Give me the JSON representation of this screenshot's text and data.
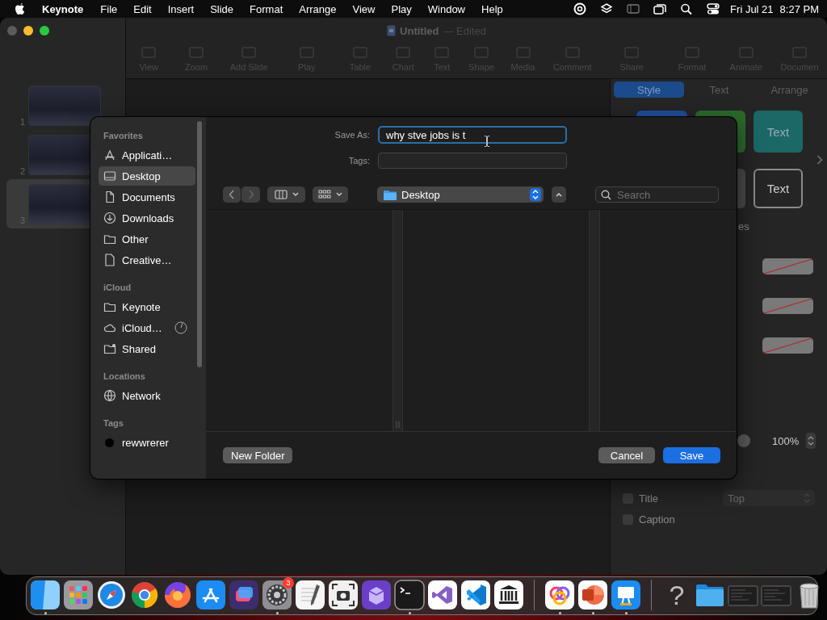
{
  "menu_bar": {
    "app_name": "Keynote",
    "menus": [
      "File",
      "Edit",
      "Insert",
      "Slide",
      "Format",
      "Arrange",
      "View",
      "Play",
      "Window",
      "Help"
    ],
    "date": "Fri Jul 21",
    "time": "8:27 PM"
  },
  "window": {
    "title": "Untitled",
    "status": "— Edited",
    "toolbar": [
      "View",
      "Zoom",
      "Add Slide",
      "Play",
      "Table",
      "Chart",
      "Text",
      "Shape",
      "Media",
      "Comment",
      "Share",
      "Format",
      "Animate",
      "Documen"
    ]
  },
  "slides": [
    {
      "number": "1",
      "selected": false
    },
    {
      "number": "2",
      "selected": false
    },
    {
      "number": "3",
      "selected": true
    }
  ],
  "inspector": {
    "tabs": [
      {
        "label": "Style",
        "selected": true
      },
      {
        "label": "Text",
        "selected": false
      },
      {
        "label": "Arrange",
        "selected": false
      }
    ],
    "presets": [
      {
        "kind": "filled",
        "color": "#1e4f9c"
      },
      {
        "kind": "filled",
        "color": "#2c6a2c"
      },
      {
        "kind": "filled",
        "color": "#1b6866",
        "label": "Text"
      },
      {
        "kind": "filled",
        "color": "#4a4a4a"
      },
      {
        "kind": "outlined",
        "label": "Text"
      }
    ],
    "section_heading": "es",
    "fill_wells": [
      {
        "kind": "empty"
      },
      {
        "kind": "empty"
      },
      {
        "kind": "empty"
      }
    ],
    "opacity": {
      "reading": "100%"
    },
    "options": [
      {
        "label": "Title",
        "checked": false
      },
      {
        "label": "Caption",
        "checked": false
      }
    ],
    "position_popup": {
      "value": "Top",
      "disabled": true
    }
  },
  "save_dialog": {
    "sidebar": [
      {
        "heading": "Favorites",
        "items": [
          {
            "label": "Applicati…",
            "kind": "apps",
            "selected": false,
            "syncing": false
          },
          {
            "label": "Desktop",
            "kind": "desktop",
            "selected": true,
            "syncing": false
          },
          {
            "label": "Documents",
            "kind": "document",
            "selected": false,
            "syncing": false
          },
          {
            "label": "Downloads",
            "kind": "download",
            "selected": false,
            "syncing": false
          },
          {
            "label": "Other",
            "kind": "folder",
            "selected": false,
            "syncing": false
          },
          {
            "label": "Creative…",
            "kind": "file",
            "selected": false,
            "syncing": false
          }
        ]
      },
      {
        "heading": "iCloud",
        "items": [
          {
            "label": "Keynote",
            "kind": "folder",
            "selected": false,
            "syncing": false
          },
          {
            "label": "iCloud…",
            "kind": "cloud",
            "selected": false,
            "syncing": true
          },
          {
            "label": "Shared",
            "kind": "shared",
            "selected": false,
            "syncing": false
          }
        ]
      },
      {
        "heading": "Locations",
        "items": [
          {
            "label": "Network",
            "kind": "globe",
            "selected": false,
            "syncing": false
          }
        ]
      },
      {
        "heading": "Tags",
        "items": [
          {
            "label": "rewwrerer",
            "kind": "tag",
            "color": "#000000",
            "selected": false,
            "syncing": false
          }
        ]
      }
    ],
    "save_as_label": "Save As:",
    "file_name": "why stve jobs is t",
    "tags_label": "Tags:",
    "location": "Desktop",
    "search_placeholder": "Search",
    "new_folder_button": "New Folder",
    "cancel_button": "Cancel",
    "save_button": "Save"
  },
  "dock": [
    {
      "kind": "finder",
      "running": true
    },
    {
      "kind": "launchpad",
      "running": false
    },
    {
      "kind": "safari",
      "running": false
    },
    {
      "kind": "chrome",
      "running": false
    },
    {
      "kind": "firefox",
      "running": false
    },
    {
      "kind": "appstore",
      "running": false
    },
    {
      "kind": "shortcuts",
      "running": false
    },
    {
      "kind": "settings",
      "running": true,
      "badge": "3"
    },
    {
      "kind": "textedit",
      "running": false
    },
    {
      "kind": "screenshot",
      "running": false
    },
    {
      "kind": "purple",
      "running": false
    },
    {
      "kind": "terminal",
      "running": true
    },
    {
      "kind": "vstudio",
      "running": false
    },
    {
      "kind": "vscode",
      "running": false
    },
    {
      "kind": "library",
      "running": false
    },
    {
      "kind": "separator"
    },
    {
      "kind": "cc",
      "running": true
    },
    {
      "kind": "powerpoint",
      "running": true
    },
    {
      "kind": "keynote",
      "running": true
    },
    {
      "kind": "separator"
    },
    {
      "kind": "help",
      "glyph": "?",
      "running": false
    },
    {
      "kind": "folder",
      "running": false
    },
    {
      "kind": "thumbnail",
      "running": false
    },
    {
      "kind": "thumbnail",
      "running": false
    },
    {
      "kind": "trash",
      "running": false
    }
  ]
}
